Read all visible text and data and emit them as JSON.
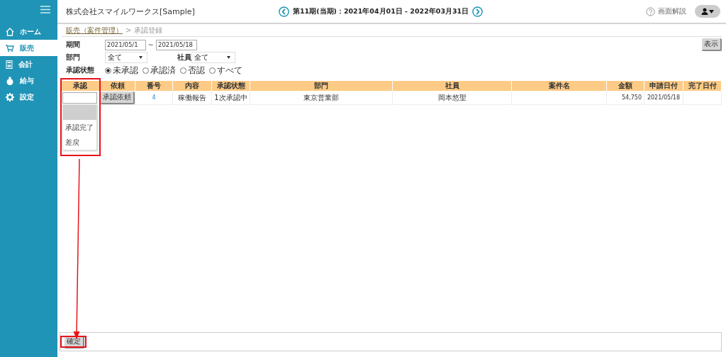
{
  "sidebar": {
    "items": [
      {
        "label": "ホーム",
        "selected": false
      },
      {
        "label": "販売",
        "selected": true
      },
      {
        "label": "会計",
        "selected": false
      },
      {
        "label": "給与",
        "selected": false
      },
      {
        "label": "設定",
        "selected": false
      }
    ]
  },
  "header": {
    "company": "株式会社スマイルワークス[Sample]",
    "period": "第11期(当期)：2021年04月01日 - 2022年03月31日",
    "help": "画面解説"
  },
  "breadcrumb": {
    "link": "販売（案件管理）",
    "separator": ">",
    "current": "承認登録"
  },
  "filters": {
    "period_label": "期間",
    "from": "2021/05/1",
    "tilde": "～",
    "to": "2021/05/18",
    "dept_label": "部門",
    "dept_value": "全て",
    "staff_label": "社員",
    "staff_value": "全て",
    "status_label": "承認状態",
    "status_options": [
      {
        "label": "未承認",
        "selected": true
      },
      {
        "label": "承認済",
        "selected": false
      },
      {
        "label": "否認",
        "selected": false
      },
      {
        "label": "すべて",
        "selected": false
      }
    ],
    "show_button": "表示"
  },
  "table": {
    "columns": [
      "承認",
      "依頼",
      "番号",
      "内容",
      "承認状態",
      "部門",
      "社員",
      "案件名",
      "金額",
      "申請日付",
      "完了日付"
    ],
    "rows": [
      {
        "request_button": "承認依頼",
        "number": "4",
        "content": "稼働報告",
        "status": "1次承認中",
        "dept": "東京営業部",
        "staff": "岡本悠聖",
        "amount": "54,750",
        "applied": "2021/05/18",
        "dropdown": {
          "open": true,
          "options": [
            {
              "selected": true
            },
            {
              "label": "承認完了",
              "selected": false
            },
            {
              "label": "差戻",
              "selected": false
            }
          ]
        }
      }
    ]
  },
  "footer": {
    "confirm_button": "確定"
  }
}
